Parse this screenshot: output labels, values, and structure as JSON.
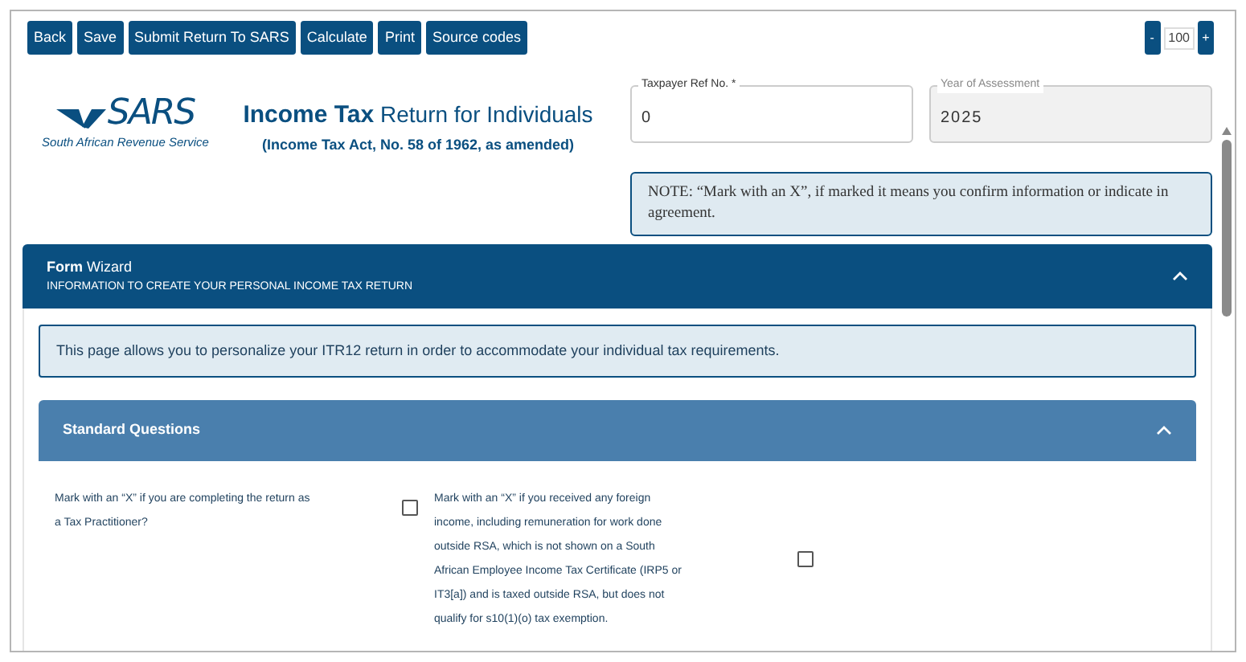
{
  "toolbar": {
    "buttons": [
      "Back",
      "Save",
      "Submit Return To SARS",
      "Calculate",
      "Print",
      "Source codes"
    ],
    "zoom": {
      "minus": "-",
      "value": "100",
      "plus": "+"
    }
  },
  "logo": {
    "wordmark": "SARS",
    "tagline": "South African Revenue Service"
  },
  "header": {
    "title": "**Income Tax** Return for Individuals",
    "subtitle": "(Income Tax Act, No. 58 of 1962, as amended)"
  },
  "fields": [
    {
      "label": "Taxpayer Ref No. *",
      "value": "0",
      "disabled": false
    },
    {
      "label": "Year of Assessment",
      "value": "2025",
      "disabled": true
    }
  ],
  "note": "NOTE: “Mark with an X”, if marked it means you confirm information or indicate in agreement.",
  "wizard": {
    "title": "**Form** Wizard",
    "subtitle": "INFORMATION TO CREATE YOUR PERSONAL INCOME TAX RETURN",
    "expanded": true
  },
  "info": "This page allows you to personalize your ITR12 return in order to accommodate your individual tax requirements.",
  "section": {
    "title": "Standard Questions",
    "expanded": true
  },
  "questions": [
    {
      "text": "Mark with an “X” if you are completing the return as a Tax Practitioner?",
      "checked": false
    },
    {
      "text": "Mark with an “X” if you received any foreign income, including remuneration for work done outside RSA, which is not shown on a South African Employee Income Tax Certificate (IRP5 or IT3[a]) and is taxed outside RSA, but does not qualify for s10(1)(o) tax exemption.",
      "checked": false
    }
  ]
}
